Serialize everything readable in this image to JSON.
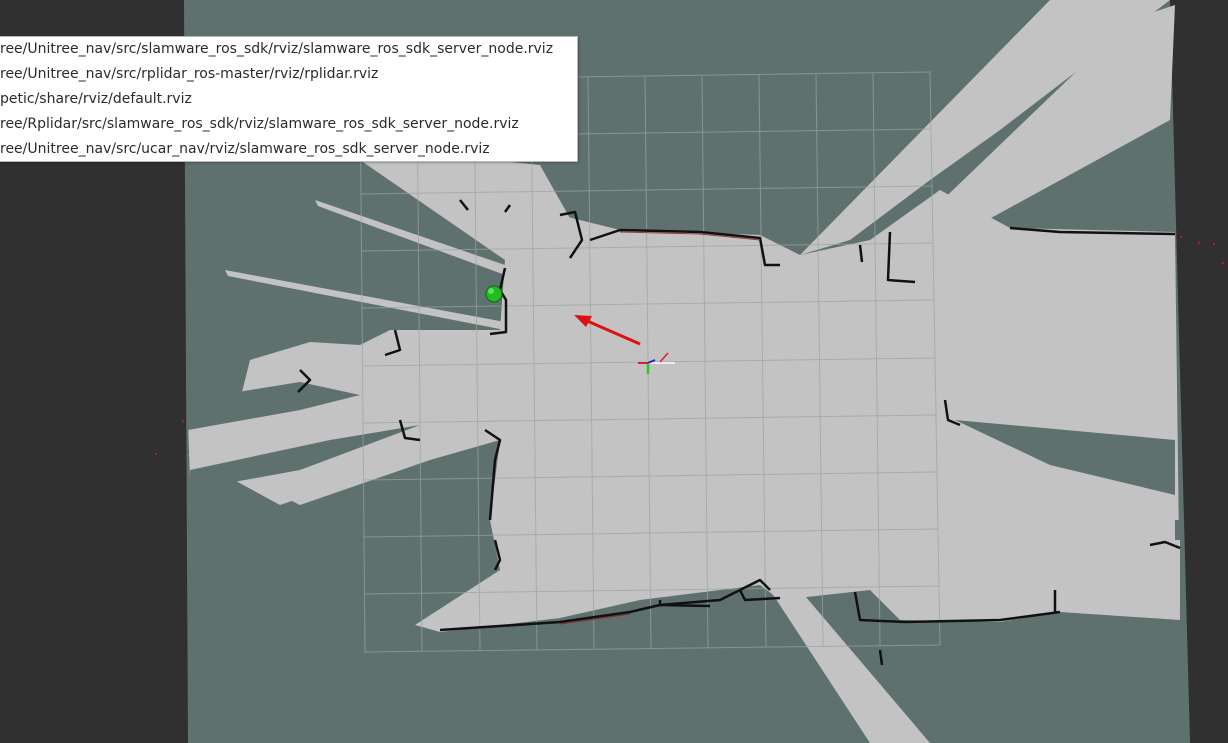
{
  "menu": {
    "recent_configs": [
      "ree/Unitree_nav/src/slamware_ros_sdk/rviz/slamware_ros_sdk_server_node.rviz",
      "ree/Unitree_nav/src/rplidar_ros-master/rviz/rplidar.rviz",
      "petic/share/rviz/default.rviz",
      "ree/Rplidar/src/slamware_ros_sdk/rviz/slamware_ros_sdk_server_node.rviz",
      "ree/Unitree_nav/src/ucar_nav/rviz/slamware_ros_sdk_server_node.rviz"
    ]
  },
  "colors": {
    "background": "#303030",
    "unknown_space": "#5f716e",
    "free_space": "#c3c3c3",
    "obstacle": "#111111",
    "grid": "#9aa4a2",
    "goal_marker": "#22bb22",
    "pose_arrow": "#dd1111"
  },
  "icons": {
    "goal": "green-sphere-marker",
    "pose": "red-pose-arrow",
    "frame": "tf-axes-icon"
  }
}
